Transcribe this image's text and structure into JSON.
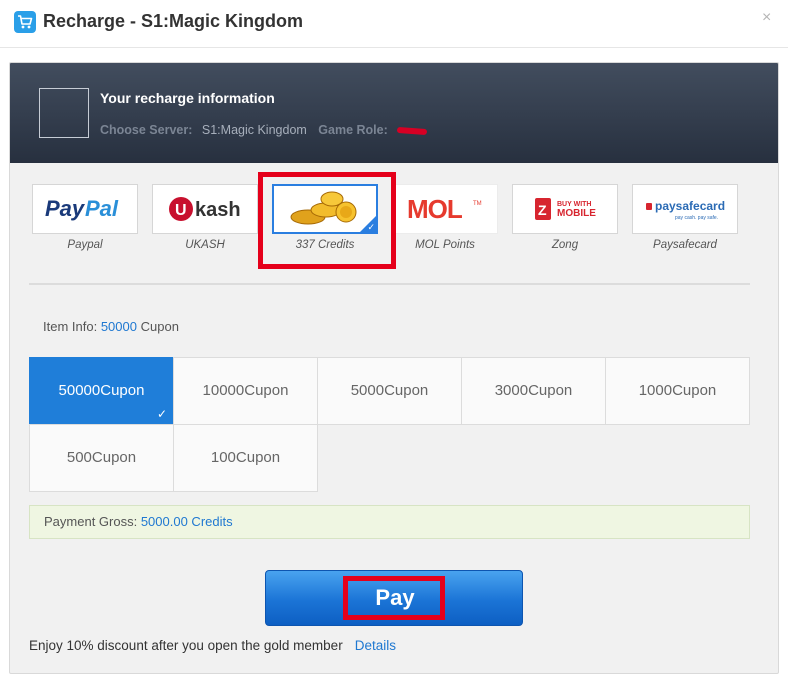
{
  "window": {
    "title": "Recharge - S1:Magic Kingdom",
    "close_symbol": "×",
    "icon": "shopping-cart-icon"
  },
  "info": {
    "title": "Your recharge information",
    "server_label": "Choose Server:",
    "server_value": "S1:Magic Kingdom",
    "role_label": "Game Role:"
  },
  "methods": [
    {
      "label": "Paypal",
      "logo": "paypal-logo",
      "selected": false
    },
    {
      "label": "UKASH",
      "logo": "ukash-logo",
      "selected": false
    },
    {
      "label": "337 Credits",
      "logo": "coins-logo",
      "selected": true
    },
    {
      "label": "MOL Points",
      "logo": "mol-logo",
      "selected": false
    },
    {
      "label": "Zong",
      "logo": "zong-logo",
      "selected": false
    },
    {
      "label": "Paysafecard",
      "logo": "paysafecard-logo",
      "selected": false
    }
  ],
  "logos": {
    "paypal_a": "Pay",
    "paypal_b": "Pal",
    "ukash_u": "U",
    "ukash_rest": "kash",
    "mol": "MOL",
    "zong_buy": "BUY WITH",
    "zong_mobile": "MOBILE",
    "paysafe": "paysafecard",
    "paysafe_tag": "pay cash. pay safe."
  },
  "item_info": {
    "label": "Item Info:",
    "amount": "50000",
    "unit": "Cupon"
  },
  "cupons": [
    {
      "label": "50000Cupon",
      "selected": true
    },
    {
      "label": "10000Cupon",
      "selected": false
    },
    {
      "label": "5000Cupon",
      "selected": false
    },
    {
      "label": "3000Cupon",
      "selected": false
    },
    {
      "label": "1000Cupon",
      "selected": false
    },
    {
      "label": "500Cupon",
      "selected": false
    },
    {
      "label": "100Cupon",
      "selected": false
    }
  ],
  "gross": {
    "label": "Payment Gross:",
    "value": "5000.00 Credits"
  },
  "pay_button": "Pay",
  "footer": {
    "text": "Enjoy 10% discount after you open the gold member",
    "link": "Details"
  },
  "colors": {
    "accent": "#1f7ed9",
    "highlight": "#e5001b",
    "header_bg": "#2f3949"
  }
}
